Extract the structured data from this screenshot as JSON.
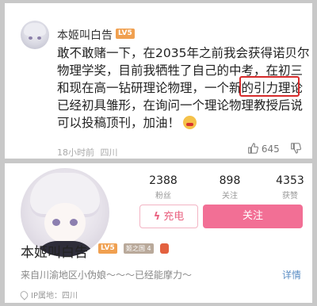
{
  "comment": {
    "username": "本姬叫白告",
    "level": "LV5",
    "lines": [
      "敢不敢赌一下，在2035年之前我会获得诺贝尔",
      "物理学奖，目前我牺牲了自己的中考，在初三",
      "和现在高一钻研理论物理，一个新的引力理论",
      "已经初具雏形，在询问一个理论物理教授后说",
      "可以投稿顶刊，加油！"
    ],
    "time": "18小时前",
    "location": "四川",
    "like_count": "645"
  },
  "profile": {
    "stats": [
      {
        "value": "2388",
        "label": "粉丝"
      },
      {
        "value": "898",
        "label": "关注"
      },
      {
        "value": "4353",
        "label": "获赞"
      }
    ],
    "charge_label": "充电",
    "follow_label": "关注",
    "username": "本姬叫白告",
    "level": "LV5",
    "fan_badge": "姬之国 4",
    "bio": "来自川渝地区小伪娘～～～已经能摩力～",
    "detail_label": "详情",
    "ip_label": "IP属地：四川"
  },
  "colors": {
    "accent_pink": "#f26f95",
    "highlight_red": "#d62b2b",
    "level_orange": "#f0a050"
  }
}
